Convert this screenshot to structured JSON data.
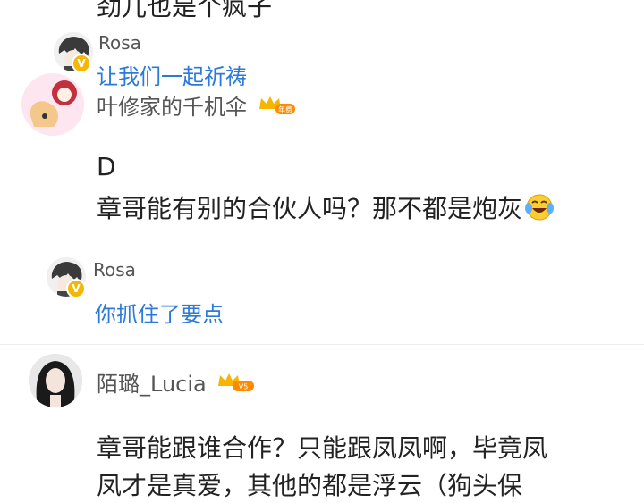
{
  "top_line_fragment": "劲儿也是个疯子",
  "threads": [
    {
      "reply": {
        "user": "Rosa",
        "text": "让我们一起祈祷"
      },
      "parent_user": "叶修家的千机伞",
      "parent_badge": "年费"
    },
    {
      "comment_lines": [
        "D",
        "章哥能有别的合伙人吗？那不都是炮灰"
      ],
      "emoji": "laughing-tears-emoji",
      "reply": {
        "user": "Rosa",
        "text": "你抓住了要点"
      }
    },
    {
      "user": "陌璐_Lucia",
      "badge": "V5",
      "comment_lines": [
        "章哥能跟谁合作？只能跟凤凤啊，毕竟凤",
        "凤才是真爱，其他的都是浮云（狗头保"
      ]
    }
  ],
  "colors": {
    "link_blue": "#2b79d8",
    "vip_gold": "#f5b800",
    "badge_orange": "#ff8a00"
  }
}
